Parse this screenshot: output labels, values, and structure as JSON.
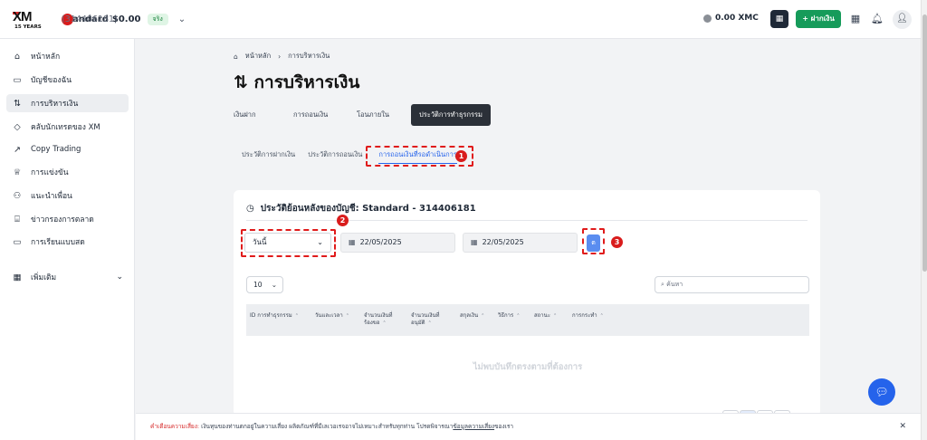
{
  "header": {
    "logo_text": "XM",
    "logo_sub": "15 YEARS",
    "account_name": "Standard",
    "account_number": "(314406181)",
    "balance": "$0.00",
    "account_badge": "จริง",
    "xmc": "0.00 XMC",
    "deposit_label": "+ ฝากเงิน"
  },
  "sidebar": {
    "items": [
      {
        "label": "หน้าหลัก",
        "icon": "home-icon"
      },
      {
        "label": "บัญชีของฉัน",
        "icon": "wallet-icon"
      },
      {
        "label": "การบริหารเงิน",
        "icon": "transfer-arrows-icon"
      },
      {
        "label": "คลับนักเทรดของ XM",
        "icon": "diamond-icon"
      },
      {
        "label": "Copy Trading",
        "icon": "trend-up-icon"
      },
      {
        "label": "การแข่งขัน",
        "icon": "trophy-icon"
      },
      {
        "label": "แนะนำเพื่อน",
        "icon": "people-icon"
      },
      {
        "label": "ข่าวกรองการตลาด",
        "icon": "bank-icon"
      },
      {
        "label": "การเรียนแบบสด",
        "icon": "video-icon"
      }
    ],
    "more_label": "เพิ่มเติม"
  },
  "breadcrumb": {
    "home": "หน้าหลัก",
    "current": "การบริหารเงิน"
  },
  "page_title": "การบริหารเงิน",
  "tabs": [
    "เงินฝาก",
    "การถอนเงิน",
    "โอนภายใน",
    "ประวัติการทำธุรกรรม"
  ],
  "subtabs": [
    "ประวัติการฝากเงิน",
    "ประวัติการถอนเงิน",
    "การถอนเงินที่รอดำเนินการ"
  ],
  "card": {
    "title": "ประวัติย้อนหลังของบัญชี: Standard - 314406181",
    "period": "วันนี้",
    "date_from": "22/05/2025",
    "date_to": "22/05/2025",
    "go_label": "ต",
    "per_page": "10",
    "search_placeholder": "ค้นหา",
    "columns": [
      "ID การทำธุรกรรม",
      "วันและเวลา",
      "จำนวนเงินที่ร้องขอ",
      "จำนวนเงินที่อนุมัติ",
      "สกุลเงิน",
      "วิธีการ",
      "สถานะ",
      "การกระทำ"
    ],
    "empty": "ไม่พบบันทึกตรงตามที่ต้องการ"
  },
  "annotations": [
    "1",
    "2",
    "3"
  ],
  "warning": {
    "label": "คำเตือนความเสี่ยง:",
    "text": " เงินทุนของท่านตกอยู่ในความเสี่ยง ผลิตภัณฑ์ที่มีเลเวอเรจอาจไม่เหมาะสำหรับทุกท่าน โปรดพิจารณา",
    "link": "ข้อมูลความเสี่ยง",
    "suffix": "ของเรา"
  },
  "colors": {
    "accent": "#2563eb",
    "deposit": "#169b5a",
    "annotation": "#e01b1b",
    "active_tab": "#2b3038"
  }
}
